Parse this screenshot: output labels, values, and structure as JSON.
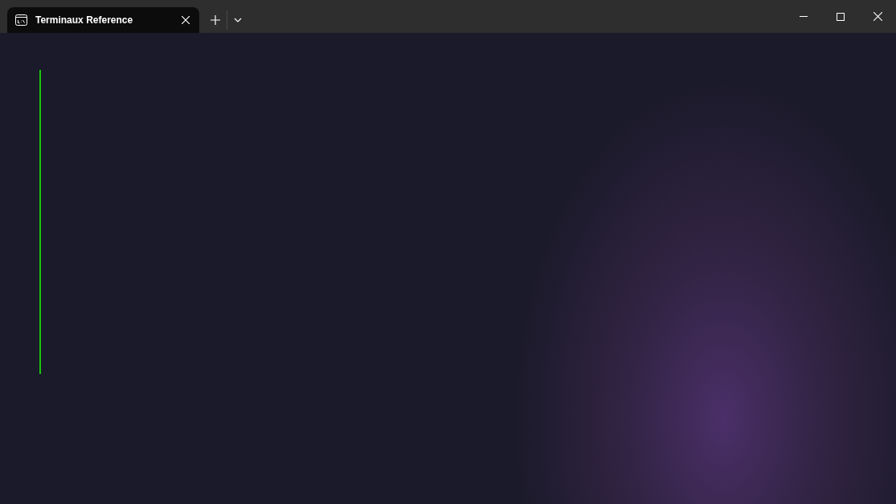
{
  "tabs": [
    {
      "title": "Terminaux Reference",
      "selected": true
    }
  ],
  "terminal": {
    "cursor_visible": true
  }
}
